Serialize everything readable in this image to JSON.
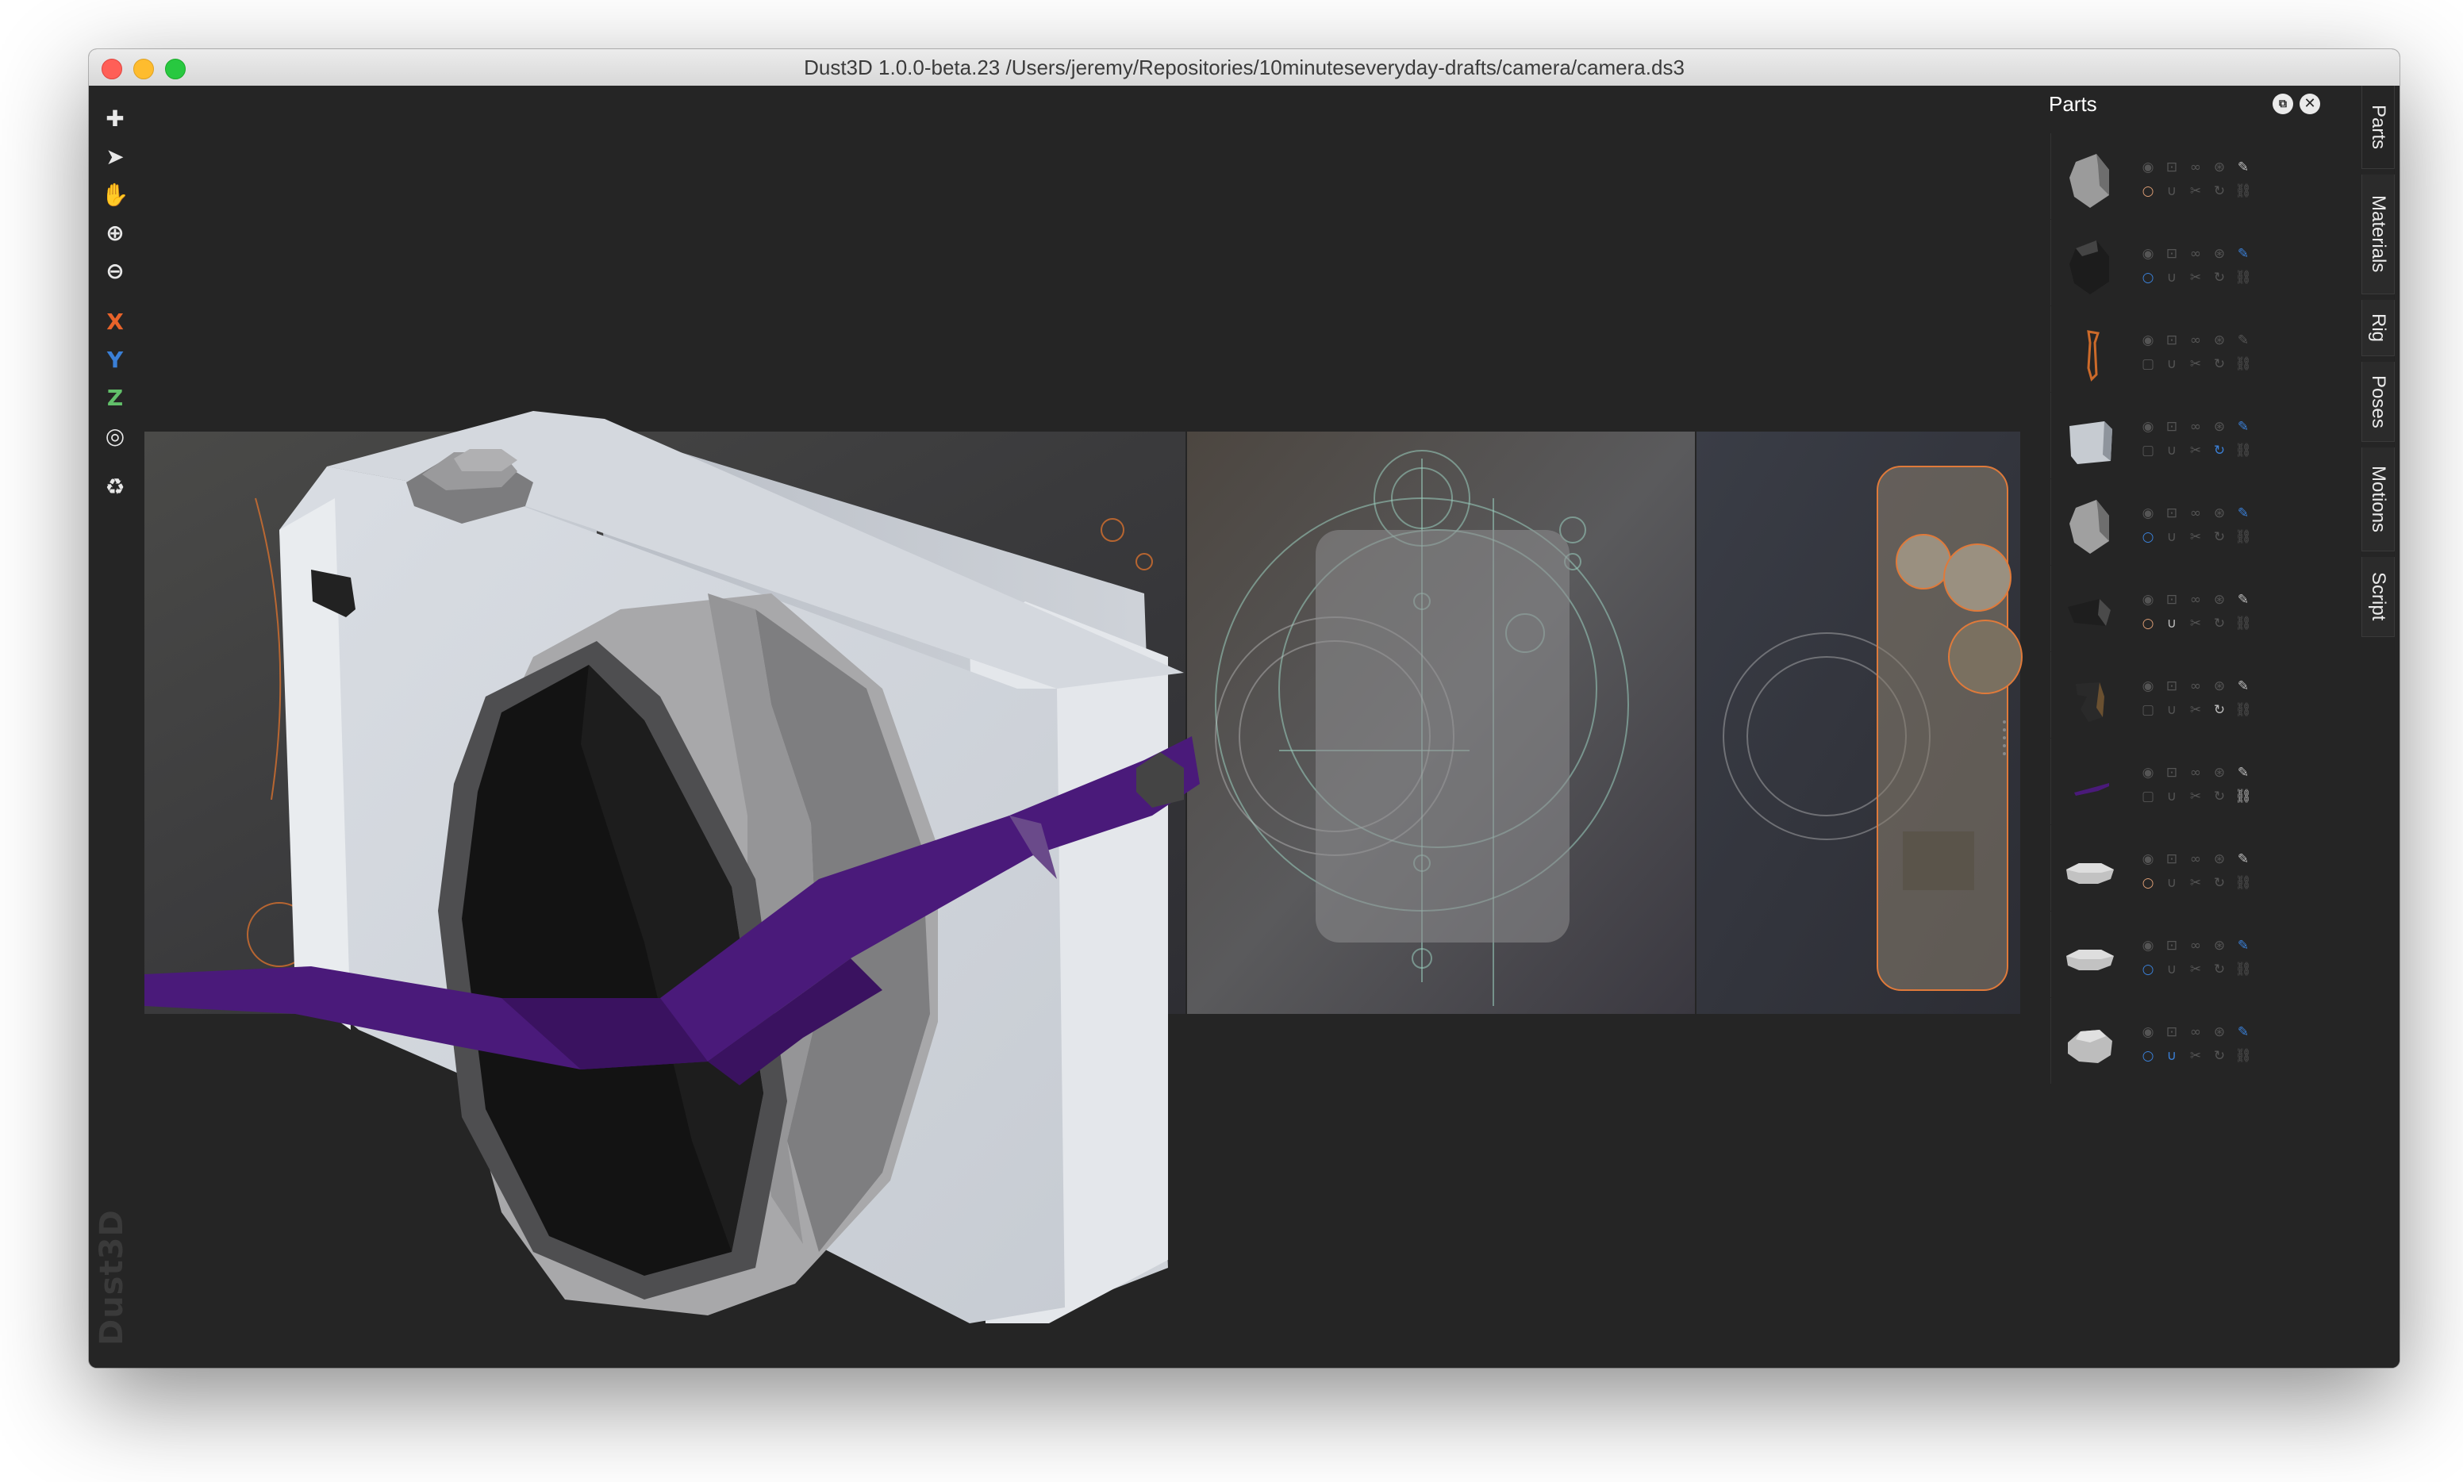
{
  "window": {
    "title": "Dust3D 1.0.0-beta.23 /Users/jeremy/Repositories/10minuteseveryday-drafts/camera/camera.ds3"
  },
  "toolbar": {
    "tools": [
      {
        "name": "add-icon",
        "glyph": "✚"
      },
      {
        "name": "select-icon",
        "glyph": "➤"
      },
      {
        "name": "hand-icon",
        "glyph": "✋"
      },
      {
        "name": "zoom-in-icon",
        "glyph": "⊕"
      },
      {
        "name": "zoom-out-icon",
        "glyph": "⊖"
      }
    ],
    "axes": {
      "x": "X",
      "y": "Y",
      "z": "Z"
    },
    "extra": [
      {
        "name": "radius-icon",
        "glyph": "◎"
      },
      {
        "name": "recycle-icon",
        "glyph": "♻"
      }
    ]
  },
  "watermark": "Dust3D",
  "parts_panel": {
    "title": "Parts",
    "float_glyph": "⧉",
    "close_glyph": "✕",
    "parts": [
      {
        "shape": "hex-light",
        "color": "#9b9b9b",
        "circle": "orange",
        "brush": "light"
      },
      {
        "shape": "hex-dark",
        "color": "#1c1c1c",
        "circle": "blue",
        "brush": "blue"
      },
      {
        "shape": "strap-orange",
        "color": "#cc6a2a",
        "circle": "none",
        "brush": "dim"
      },
      {
        "shape": "box-light",
        "color": "#c6cbd1",
        "circle": "none",
        "brush": "blue",
        "mirror": "blue"
      },
      {
        "shape": "hex-light",
        "color": "#a0a0a0",
        "circle": "blue",
        "brush": "blue"
      },
      {
        "shape": "bar-dark",
        "color": "#1e1e1e",
        "circle": "orange",
        "brush": "light",
        "magnet": "on"
      },
      {
        "shape": "lug-dark",
        "color": "#2a2a2a",
        "circle": "none",
        "brush": "light",
        "mirror": "on"
      },
      {
        "shape": "strap-purple",
        "color": "#4a1a7a",
        "circle": "none",
        "brush": "light",
        "chain": "on"
      },
      {
        "shape": "disc-light",
        "color": "#c2c2c2",
        "circle": "orange",
        "brush": "light"
      },
      {
        "shape": "disc-light",
        "color": "#c2c2c2",
        "circle": "blue",
        "brush": "blue"
      },
      {
        "shape": "knob-light",
        "color": "#bdbdbd",
        "circle": "blue",
        "brush": "blue",
        "magnet": "blue"
      }
    ]
  },
  "side_tabs": [
    "Parts",
    "Materials",
    "Rig",
    "Poses",
    "Motions",
    "Script"
  ],
  "colors": {
    "canvas": "#252525",
    "camera_body": "#dde1e6",
    "strap": "#4a1a7a",
    "axis_x": "#e8632a",
    "axis_y": "#3a7fd6",
    "axis_z": "#62c06a"
  }
}
